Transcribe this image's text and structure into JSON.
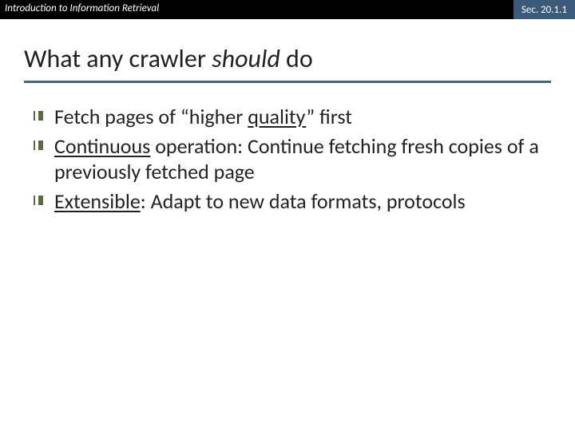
{
  "header": {
    "left": "Introduction to Information Retrieval",
    "right": "Sec. 20.1.1"
  },
  "title": {
    "pre": "What any crawler ",
    "ital": "should",
    "post": " do"
  },
  "bullets": {
    "b1": {
      "t1": "Fetch pages of “higher ",
      "u1": "quality",
      "t2": "” first"
    },
    "b2": {
      "u1": "Continuous",
      "t1": " operation: Continue fetching fresh copies of a previously fetched page"
    },
    "b3": {
      "u1": "Extensible",
      "t1": ": Adapt to new data formats, protocols"
    }
  }
}
